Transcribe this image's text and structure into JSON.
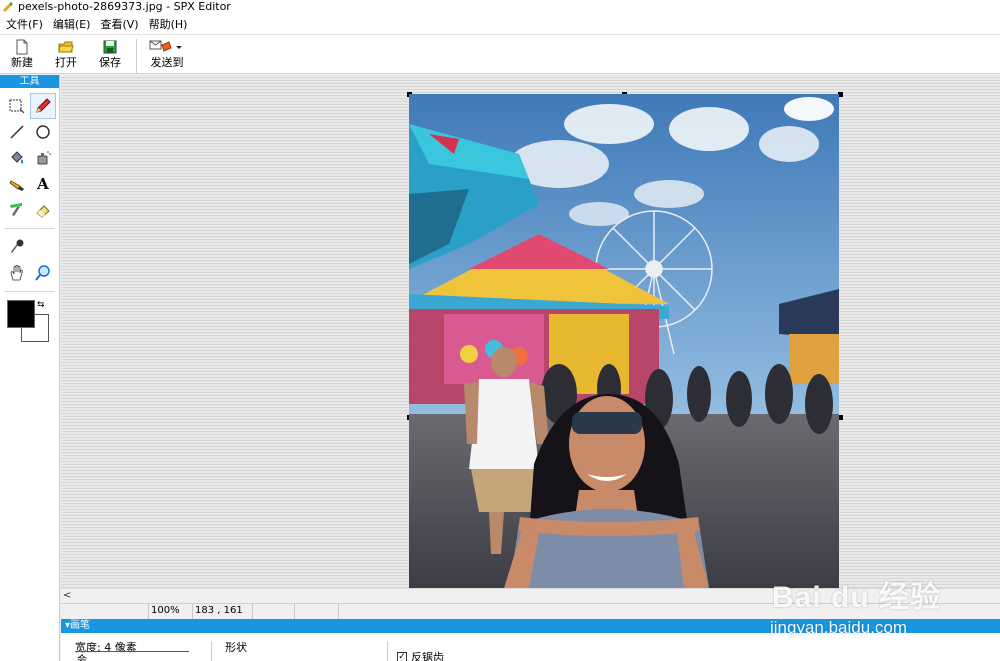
{
  "window": {
    "title": "pexels-photo-2869373.jpg - SPX Editor"
  },
  "menu": {
    "items": [
      "文件(F)",
      "编辑(E)",
      "查看(V)",
      "帮助(H)"
    ]
  },
  "toolbar": {
    "new_label": "新建",
    "open_label": "打开",
    "save_label": "保存",
    "send_label": "发送到"
  },
  "tools_panel": {
    "title": "工具",
    "tools": [
      "rect-select-icon",
      "pencil-icon",
      "line-icon",
      "ellipse-icon",
      "fill-bucket-icon",
      "spray-icon",
      "brush-icon",
      "text-icon",
      "highlighter-icon",
      "eraser-icon",
      "color-picker-icon",
      "hand-icon",
      "zoom-icon"
    ],
    "active_tool": "pencil-icon",
    "text_tool_glyph": "A"
  },
  "colors": {
    "foreground": "#000000",
    "background": "#ffffff",
    "accent": "#1a96e0"
  },
  "status": {
    "zoom": "100%",
    "coords": "183 , 161"
  },
  "brush_panel": {
    "title": "画笔",
    "width_label": "宽度: 4 像素",
    "extra_label": "会",
    "shape_label": "形状",
    "antialias_label": "反锯齿",
    "antialias_checked": true
  },
  "watermark": {
    "logo": "Bai du 经验",
    "url": "jingyan.baidu.com"
  }
}
